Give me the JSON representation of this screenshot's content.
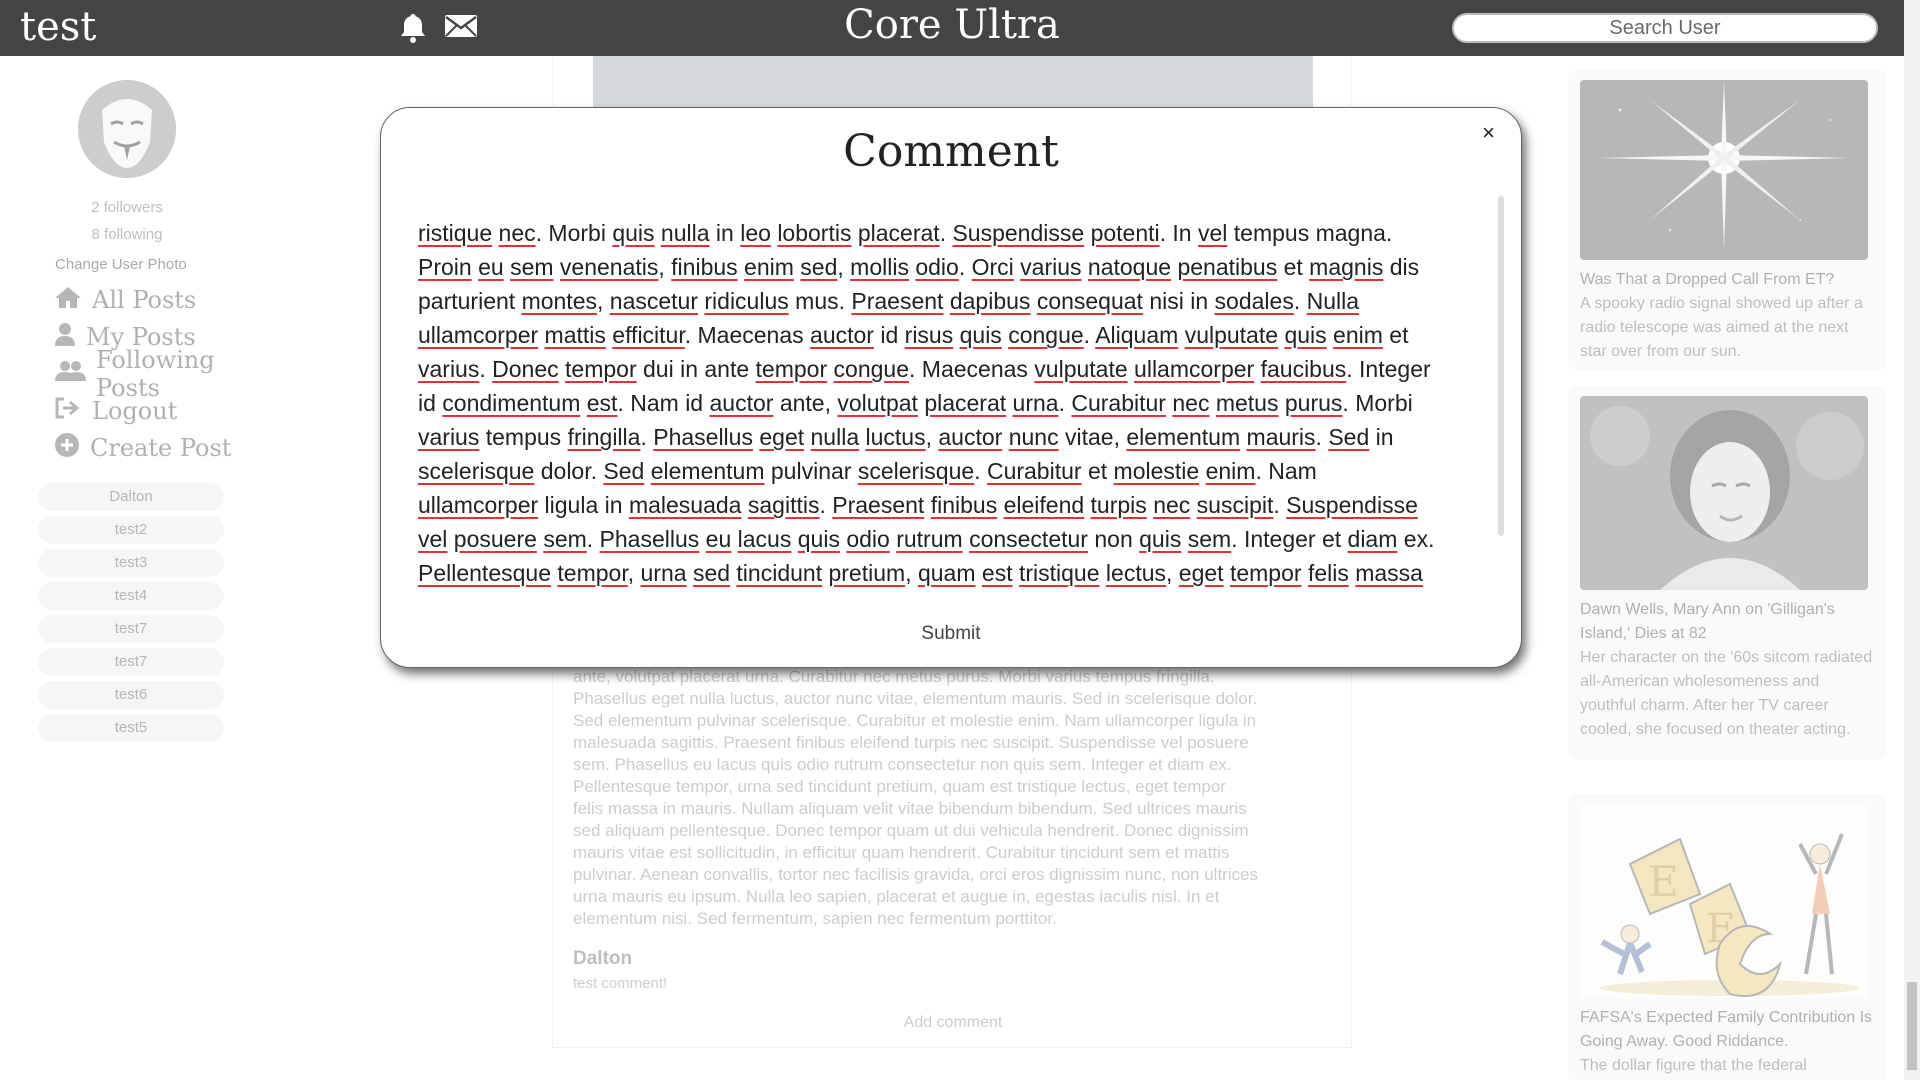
{
  "header": {
    "brand": "test",
    "app_title": "Core Ultra",
    "search_placeholder": "Search User"
  },
  "sidebar": {
    "followers": "2 followers",
    "following": "8 following",
    "change_photo": "Change User Photo",
    "nav": [
      {
        "label": "All Posts",
        "icon": "home-icon"
      },
      {
        "label": "My Posts",
        "icon": "user-icon"
      },
      {
        "label": "Following Posts",
        "icon": "users-icon"
      },
      {
        "label": "Logout",
        "icon": "logout-icon"
      },
      {
        "label": "Create Post",
        "icon": "plus-circle-icon"
      }
    ],
    "users": [
      "Dalton",
      "test2",
      "test3",
      "test4",
      "test7",
      "test7",
      "test6",
      "test5"
    ]
  },
  "feed": {
    "post_text_lines": [
      "ante, volutpat placerat urna. Curabitur nec metus purus. Morbi varius tempus fringilla.",
      "Phasellus eget nulla luctus, auctor nunc vitae, elementum mauris. Sed in scelerisque dolor.",
      "Sed elementum pulvinar scelerisque. Curabitur et molestie enim. Nam ullamcorper ligula in",
      "malesuada sagittis. Praesent finibus eleifend turpis nec suscipit. Suspendisse vel posuere",
      "sem. Phasellus eu lacus quis odio rutrum consectetur non quis sem. Integer et diam ex.",
      "Pellentesque tempor, urna sed tincidunt pretium, quam est tristique lectus, eget tempor",
      "felis massa in mauris. Nullam aliquam velit vitae bibendum bibendum. Sed ultrices mauris",
      "sed aliquam pellentesque. Donec tempor quam ut dui vehicula hendrerit. Donec dignissim",
      "mauris vitae est sollicitudin, in efficitur quam hendrerit. Curabitur tincidunt sem et mattis",
      "pulvinar. Aenean convallis, tortor nec facilisis gravida, orci eros dignissim nunc, non ultrices",
      "urna mauris eu ipsum. Nulla leo sapien, placerat et augue in, egestas iaculis nisl. In et",
      "elementum nisi. Sed fermentum, sapien nec fermentum porttitor."
    ],
    "comment_author": "Dalton",
    "comment_text": "test comment!",
    "add_comment": "Add comment"
  },
  "news": [
    {
      "title": "Was That a Dropped Call From ET?",
      "desc": "A spooky radio signal showed up after a radio telescope was aimed at the next star over from our sun."
    },
    {
      "title": "Dawn Wells, Mary Ann on 'Gilligan's Island,' Dies at 82",
      "desc": "Her character on the '60s sitcom radiated all-American wholesomeness and youthful charm. After her TV career cooled, she focused on theater acting."
    },
    {
      "title": "FAFSA's Expected Family Contribution Is Going Away. Good Riddance.",
      "desc": "The dollar figure that the federal"
    }
  ],
  "modal": {
    "title": "Comment",
    "close": "×",
    "submit": "Submit",
    "text_lines": [
      "ristique nec. Morbi quis nulla in leo lobortis placerat. Suspendisse potenti. In vel tempus magna.",
      "Proin eu sem venenatis, finibus enim sed, mollis odio. Orci varius natoque penatibus et magnis dis",
      "parturient montes, nascetur ridiculus mus. Praesent dapibus consequat nisi in sodales. Nulla",
      "ullamcorper mattis efficitur. Maecenas auctor id risus quis congue. Aliquam vulputate quis enim et",
      "varius. Donec tempor dui in ante tempor congue. Maecenas vulputate ullamcorper faucibus. Integer",
      "id condimentum est. Nam id auctor ante, volutpat placerat urna. Curabitur nec metus purus. Morbi",
      "varius tempus fringilla. Phasellus eget nulla luctus, auctor nunc vitae, elementum mauris. Sed in",
      "scelerisque dolor. Sed elementum pulvinar scelerisque. Curabitur et molestie enim. Nam",
      "ullamcorper ligula in malesuada sagittis. Praesent finibus eleifend turpis nec suscipit. Suspendisse",
      "vel posuere sem. Phasellus eu lacus quis odio rutrum consectetur non quis sem. Integer et diam ex.",
      "Pellentesque tempor, urna sed tincidunt pretium, quam est tristique lectus, eget tempor felis massa"
    ],
    "spellcheck_words": [
      "ristique",
      "nec",
      "quis",
      "nulla",
      "leo",
      "lobortis",
      "placerat",
      "Suspendisse",
      "potenti",
      "vel",
      "Proin",
      "eu",
      "sem",
      "venenatis",
      "finibus",
      "enim",
      "sed",
      "mollis",
      "odio",
      "Orci",
      "varius",
      "natoque",
      "penatibus",
      "magnis",
      "montes",
      "nascetur",
      "ridiculus",
      "Praesent",
      "dapibus",
      "consequat",
      "sodales",
      "Nulla",
      "ullamcorper",
      "mattis",
      "efficitur",
      "auctor",
      "risus",
      "congue",
      "Aliquam",
      "vulputate",
      "Donec",
      "tempor",
      "faucibus",
      "condimentum",
      "volutpat",
      "urna",
      "Curabitur",
      "metus",
      "purus",
      "fringilla",
      "Phasellus",
      "eget",
      "luctus",
      "nunc",
      "elementum",
      "mauris",
      "Sed",
      "scelerisque",
      "molestie",
      "malesuada",
      "sagittis",
      "eleifend",
      "turpis",
      "suscipit",
      "posuere",
      "lacus",
      "rutrum",
      "consectetur",
      "diam",
      "Pellentesque",
      "tincidunt",
      "pretium",
      "quam",
      "est",
      "tristique",
      "lectus",
      "felis",
      "massa"
    ]
  }
}
